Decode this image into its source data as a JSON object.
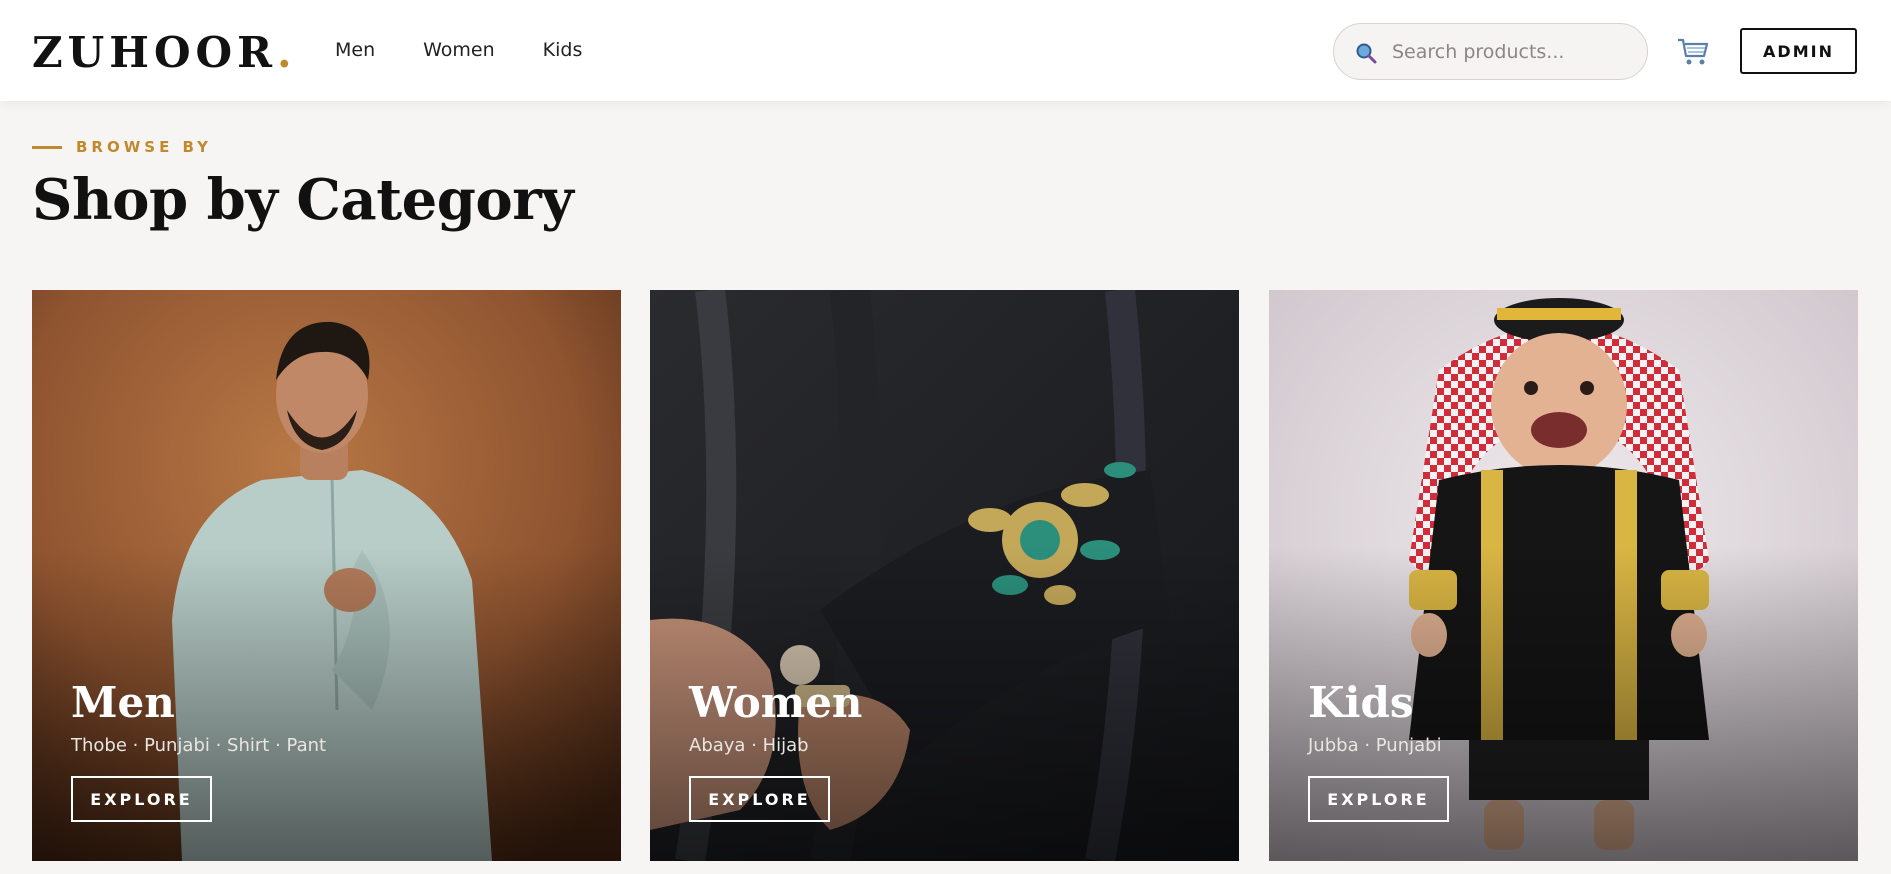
{
  "brand": {
    "name": "ZUHOOR",
    "dot": ".",
    "accent": "#c08a2c"
  },
  "nav": {
    "items": [
      {
        "label": "Men"
      },
      {
        "label": "Women"
      },
      {
        "label": "Kids"
      }
    ]
  },
  "search": {
    "placeholder": "Search products...",
    "icon": "magnifier-icon"
  },
  "cart": {
    "icon": "shopping-cart-icon"
  },
  "admin": {
    "label": "ADMIN"
  },
  "section": {
    "eyebrow": "BROWSE BY",
    "title": "Shop by Category"
  },
  "categories": [
    {
      "name": "Men",
      "subtitle": "Thobe · Punjabi · Shirt · Pant",
      "cta": "EXPLORE"
    },
    {
      "name": "Women",
      "subtitle": "Abaya · Hijab",
      "cta": "EXPLORE"
    },
    {
      "name": "Kids",
      "subtitle": "Jubba · Punjabi",
      "cta": "EXPLORE"
    }
  ]
}
